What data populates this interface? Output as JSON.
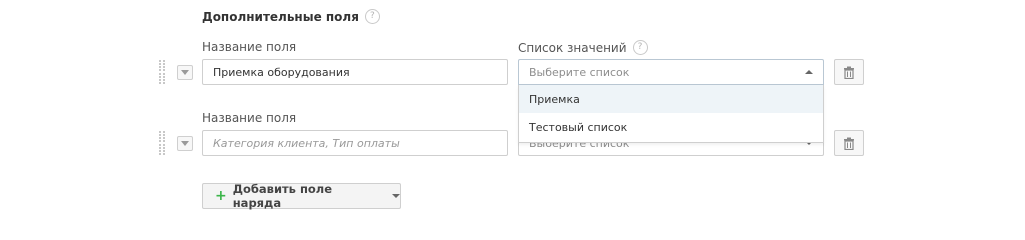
{
  "section": {
    "title": "Дополнительные поля",
    "help_glyph": "?"
  },
  "rows": [
    {
      "name_label": "Название поля",
      "name_value": "Приемка оборудования",
      "list_label": "Список значений",
      "list_help_glyph": "?",
      "list_placeholder": "Выберите список",
      "dropdown_open": true
    },
    {
      "name_label": "Название поля",
      "name_placeholder": "Категория клиента, Тип оплаты",
      "list_placeholder": "Выберите список",
      "dropdown_open": false
    }
  ],
  "dropdown": {
    "options": [
      "Приемка",
      "Тестовый список"
    ]
  },
  "add_button": {
    "label": "Добавить поле наряда",
    "plus_glyph": "+"
  },
  "colors": {
    "accent_green": "#3bb54a",
    "border": "#cfcfcf",
    "hover": "#eef4f8"
  },
  "icons": [
    "help-icon",
    "drag-handle-icon",
    "collapse-icon",
    "trash-icon",
    "plus-icon",
    "chevron-up-icon",
    "chevron-down-icon"
  ]
}
